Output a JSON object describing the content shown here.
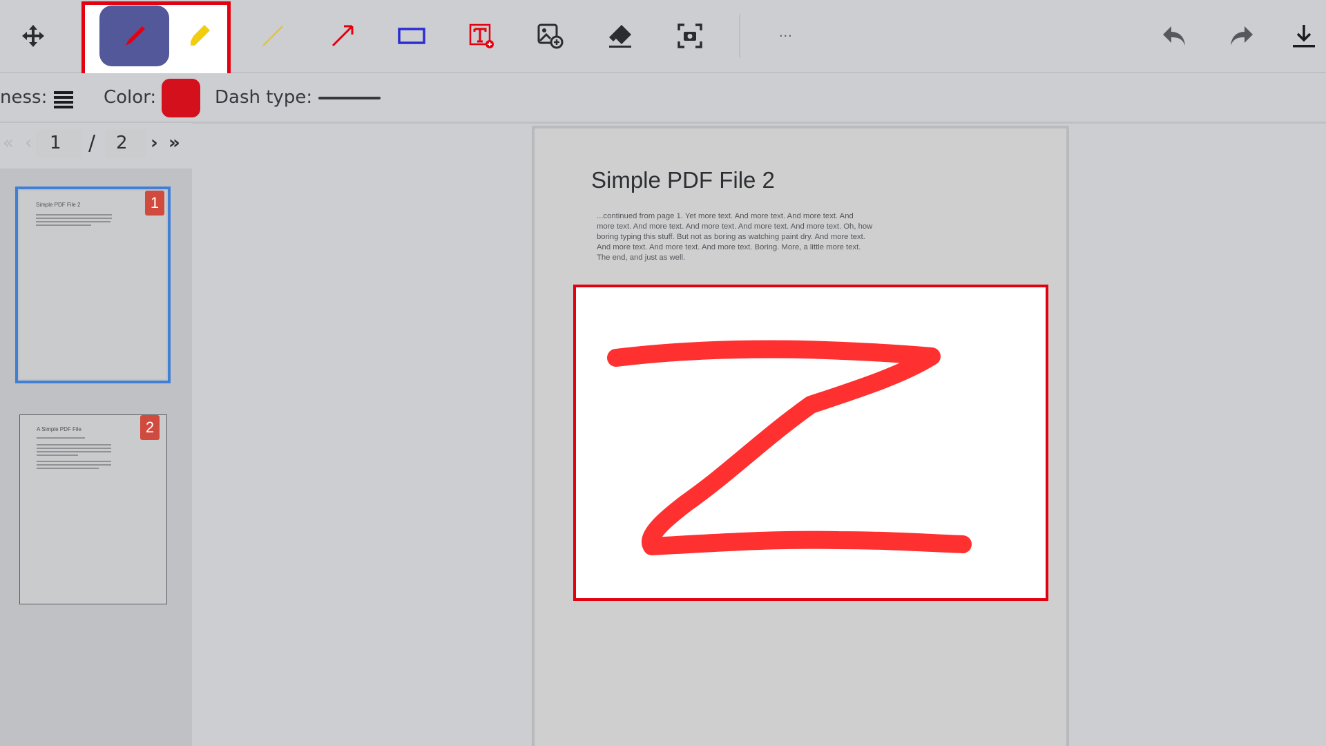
{
  "toolbar": {
    "tools": [
      "move-icon",
      "pen-icon",
      "highlighter-icon",
      "line-icon",
      "arrow-icon",
      "rectangle-icon",
      "text-icon",
      "add-image-icon",
      "eraser-icon",
      "screenshot-icon"
    ],
    "active_tool": "pen",
    "more_label": "...",
    "actions": [
      "undo-icon",
      "redo-icon",
      "download-icon"
    ],
    "colors": {
      "accent": "#53589a",
      "highlight_outline": "#e3000f",
      "pen": "#e3000f",
      "highlighter": "#f2cc0f",
      "rectangle": "#2b2bd6"
    }
  },
  "options": {
    "thickness_label": "ness:",
    "color_label": "Color:",
    "color_value": "#d3101c",
    "dash_label": "Dash type:"
  },
  "pager": {
    "first": "«",
    "prev": "‹",
    "current": "1",
    "separator": "/",
    "total": "2",
    "next": "›",
    "last": "»"
  },
  "thumbnails": [
    {
      "badge": "1",
      "title": "Simple PDF File 2",
      "selected": true
    },
    {
      "badge": "2",
      "title": "A Simple PDF File",
      "selected": false
    }
  ],
  "document": {
    "title": "Simple PDF File 2",
    "body": "...continued from page 1. Yet more text. And more text. And more text. And more text. And more text. And more text. And more text. And more text. Oh, how boring typing this stuff. But not as boring as watching paint dry. And more text. And more text. And more text. And more text. Boring.  More, a little more text. The end, and just as well.",
    "signature_box": {
      "drawn_letter": "Z",
      "stroke_color": "#ff3030"
    }
  }
}
